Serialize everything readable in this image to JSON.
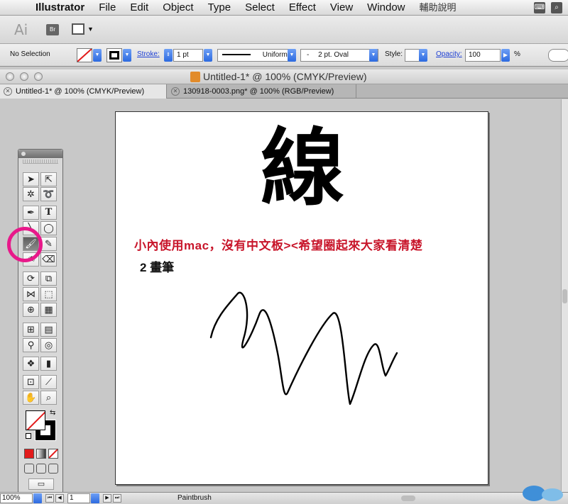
{
  "menubar": {
    "apple_icon": "apple-icon",
    "items": [
      "Illustrator",
      "File",
      "Edit",
      "Object",
      "Type",
      "Select",
      "Effect",
      "View",
      "Window"
    ],
    "extra": "輔助說明"
  },
  "appbar": {
    "logo": "Ai",
    "bridge": "Br"
  },
  "control": {
    "selection": "No Selection",
    "stroke_label": "Stroke:",
    "stroke_weight": "1 pt",
    "profile": "Uniform",
    "brush_dash": "-",
    "brush": "2 pt. Oval",
    "style_label": "Style:",
    "opacity_label": "Opacity:",
    "opacity": "100",
    "percent": "%"
  },
  "window": {
    "title": "Untitled-1* @ 100% (CMYK/Preview)"
  },
  "tabs": [
    {
      "label": "Untitled-1* @ 100% (CMYK/Preview)"
    },
    {
      "label": "130918-0003.png* @ 100% (RGB/Preview)"
    }
  ],
  "artboard": {
    "big_char": "線",
    "red_caption": "小內使用mac，沒有中文板><希望圈起來大家看清楚",
    "black_caption": "2 畫筆"
  },
  "status": {
    "zoom": "100%",
    "page": "1",
    "tool_name": "Paintbrush"
  },
  "colors": {
    "highlight_ring": "#e8198a",
    "caption_red": "#c8152a"
  }
}
